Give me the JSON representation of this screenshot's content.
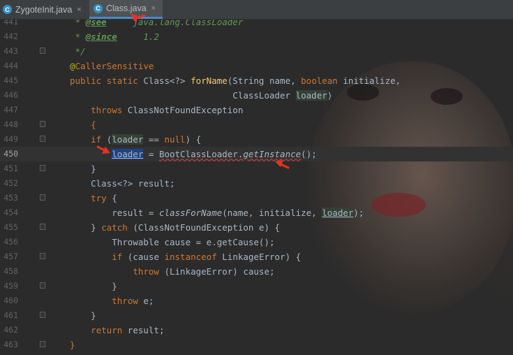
{
  "tabs": [
    {
      "label": "ZygoteInit.java",
      "active": false,
      "icon": "class-c-icon",
      "close": "×"
    },
    {
      "label": "Class.java",
      "active": true,
      "icon": "class-c-icon",
      "close": "×"
    }
  ],
  "icon_letter": "C",
  "colors": {
    "background": "#2b2b2b",
    "keyword": "#cc7832",
    "annotation": "#bbb529",
    "method": "#ffc66d",
    "doc": "#629755",
    "arrow": "#e8321f"
  },
  "lines": [
    {
      "num": "441",
      "t0": " * ",
      "t1": "@see",
      "t2": "     java.lang.ClassLoader"
    },
    {
      "num": "442",
      "t0": " * ",
      "t1": "@since",
      "t2": "     1.2"
    },
    {
      "num": "443",
      "t0": " */"
    },
    {
      "num": "444",
      "t0": "@",
      "t1": "CallerSensitive"
    },
    {
      "num": "445",
      "t0": "public static ",
      "t1": "Class<?> ",
      "t2": "forName",
      "t3": "(String name, ",
      "t4": "boolean ",
      "t5": "initialize,"
    },
    {
      "num": "446",
      "t0": "                               ClassLoader ",
      "t1": "loader",
      "t2": ")"
    },
    {
      "num": "447",
      "t0": "    throws ",
      "t1": "ClassNotFoundException"
    },
    {
      "num": "448",
      "t0": "    {"
    },
    {
      "num": "449",
      "t0": "    ",
      "t1": "if ",
      "t2": "(",
      "t3": "loader",
      "t4": " == ",
      "t5": "null",
      "t6": ") {"
    },
    {
      "num": "450",
      "t0": "        ",
      "t1": "loader",
      "t2": " = ",
      "t3": "BootClassLoader.",
      "t4": "getInstance",
      "t5": "();"
    },
    {
      "num": "451",
      "t0": "    }"
    },
    {
      "num": "452",
      "t0": "    Class<?> result;"
    },
    {
      "num": "453",
      "t0": "    ",
      "t1": "try ",
      "t2": "{"
    },
    {
      "num": "454",
      "t0": "        result = ",
      "t1": "classForName",
      "t2": "(name, initialize, ",
      "t3": "loader",
      "t4": ");"
    },
    {
      "num": "455",
      "t0": "    } ",
      "t1": "catch ",
      "t2": "(ClassNotFoundException e) {"
    },
    {
      "num": "456",
      "t0": "        Throwable cause = e.getCause();"
    },
    {
      "num": "457",
      "t0": "        ",
      "t1": "if ",
      "t2": "(cause ",
      "t3": "instanceof ",
      "t4": "LinkageError) {"
    },
    {
      "num": "458",
      "t0": "            ",
      "t1": "throw ",
      "t2": "(LinkageError) cause;"
    },
    {
      "num": "459",
      "t0": "        }"
    },
    {
      "num": "460",
      "t0": "        ",
      "t1": "throw ",
      "t2": "e;"
    },
    {
      "num": "461",
      "t0": "    }"
    },
    {
      "num": "462",
      "t0": "    ",
      "t1": "return ",
      "t2": "result;"
    },
    {
      "num": "463",
      "t0": "}"
    }
  ]
}
